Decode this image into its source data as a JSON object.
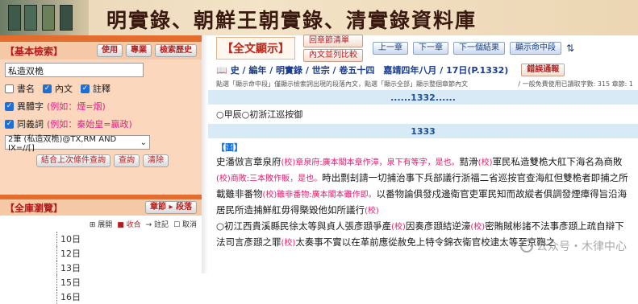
{
  "banner": {
    "title": "明實錄、朝鮮王朝實錄、清實錄資料庫"
  },
  "left": {
    "basic_search": {
      "title": "【基本檢索】",
      "buttons": [
        "使用",
        "專業",
        "檢索歷史"
      ],
      "query": "私造双桅",
      "scopes": [
        {
          "label": "書名",
          "checked": false
        },
        {
          "label": "內文",
          "checked": true
        },
        {
          "label": "註釋",
          "checked": true
        }
      ],
      "variant": {
        "label": "異體字",
        "hint": "(例如：煙=烟)",
        "checked": true
      },
      "synonym": {
        "label": "同義詞",
        "hint": "(例如：秦始皇=贏政)",
        "checked": true
      },
      "select_value": "2筆 (私造双桅)@TX,RM AND IX=//[]",
      "actions": [
        "結合上次條件查詢",
        "查詢",
        "清除"
      ]
    },
    "browse": {
      "title": "【全庫瀏覽】",
      "button": "章節 ▸ 段落",
      "legend": [
        "⊞ 展開",
        "■ 收合",
        "→ 註記",
        "☐ 取消"
      ],
      "tree_items": [
        "10日",
        "12日",
        "13日",
        "15日",
        "16日"
      ]
    }
  },
  "right": {
    "title": "【全文顯示】",
    "nav_buttons": [
      "回章節清單",
      "上一章",
      "下一章",
      "下一個結果",
      "顯示命中段"
    ],
    "nav_button2": "內文並列比較",
    "breadcrumb": "史 / 編年 / 明實錄 / 世宗 / 卷五十四　嘉靖四年八月 / 17日(P.1332)",
    "annotate_button": "錯誤通報",
    "note_left": "點選「顯示命中段」僅顯示檢索詞出現的段落內文，點選「顯示全部」顯示整個章節內文",
    "note_right": "/ 一般免費使用已讀取字數: 315 章節: 1",
    "page_top": "......1332......",
    "heading": "○甲辰○初浙江巡按御",
    "page_num": "1333",
    "para_tag": "【圖】",
    "paragraphs": [
      [
        {
          "t": "史潘倣言章泉府",
          "a": false
        },
        {
          "t": "(校)章泉府:廣本閣本章作漳，泉下有等字，是也。",
          "a": true
        },
        {
          "t": "黠滑",
          "a": false
        },
        {
          "t": "(校)",
          "a": true
        },
        {
          "t": "軍民私造雙桅大舡下海名為商敗",
          "a": false
        },
        {
          "t": "(校)商敗:三本敗作販，是也。",
          "a": true
        },
        {
          "t": "時出剽刦請一切捕治事下兵部議行浙福二省巡按官查海舡但雙桅者即捕之所載雖非番物",
          "a": false
        },
        {
          "t": "(校)雖非番物:廣本閣本雖作即。",
          "a": true
        },
        {
          "t": "以番物論俱發戍邊衛官吏軍民知而故縱者俱調發煙瘴得旨沿海居民所造捕鮮舡毋得槩毀他如所議行",
          "a": false
        },
        {
          "t": "(校)",
          "a": true
        }
      ],
      [
        {
          "t": "○初江西貴溪縣民徐太等與貞人張彥頲爭產",
          "a": false
        },
        {
          "t": "(校)",
          "a": true
        },
        {
          "t": "因奏彥頲結逆濠",
          "a": false
        },
        {
          "t": "(校)",
          "a": true
        },
        {
          "t": "密賄賊彬諸不法事彥頲上疏自辯下法司言彥頲之罪",
          "a": false
        },
        {
          "t": "(校)",
          "a": true
        },
        {
          "t": "太奏事不實以在革前應從赦免上特令錦衣衛官校逮太等至京鞫之",
          "a": false
        }
      ]
    ],
    "watermark": "公众号・木律中心"
  }
}
